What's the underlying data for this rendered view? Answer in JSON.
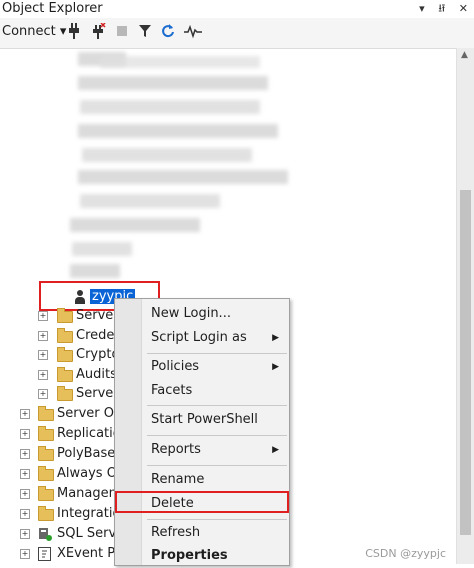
{
  "title": "Object Explorer",
  "title_icons": [
    "▾",
    "⭿",
    "✕"
  ],
  "toolbar": {
    "connect_label": "Connect",
    "connect_arrow": "▾",
    "icons": [
      "plug-icon",
      "disconnect-icon",
      "stop-icon",
      "filter-icon",
      "refresh-icon",
      "activity-icon"
    ]
  },
  "tree": {
    "selected_login": "zyypjc",
    "security_folders": [
      "Server",
      "Creder",
      "Crypto",
      "Audits",
      "Server"
    ],
    "root_items": [
      "Server Ob",
      "Replicatio",
      "PolyBase",
      "Always Or",
      "Managem",
      "Integratio",
      "SQL Serve",
      "XEvent Pro"
    ]
  },
  "context_menu": {
    "items": {
      "new_login": "New Login...",
      "script_login_as": "Script Login as",
      "policies": "Policies",
      "facets": "Facets",
      "start_powershell": "Start PowerShell",
      "reports": "Reports",
      "rename": "Rename",
      "delete": "Delete",
      "refresh": "Refresh",
      "properties": "Properties"
    },
    "submenu_arrow": "▶"
  },
  "watermark": "CSDN @zyypjc"
}
